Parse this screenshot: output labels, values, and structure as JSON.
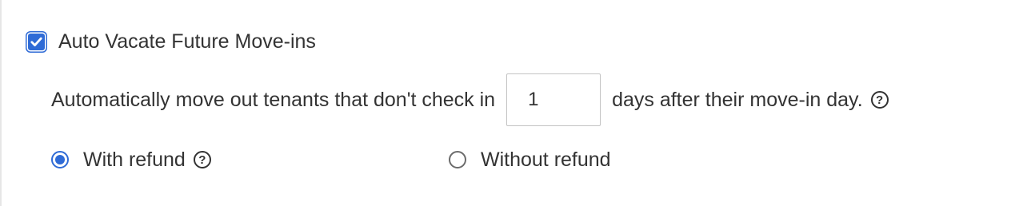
{
  "auto_vacate": {
    "checkbox_label": "Auto Vacate Future Move-ins",
    "checked": true,
    "sentence_before": "Automatically move out tenants that don't check in",
    "days_value": "1",
    "sentence_after": "days after their move-in day.",
    "help_glyph": "?"
  },
  "refund_options": {
    "selected": "with_refund",
    "with_refund_label": "With refund",
    "with_refund_help_glyph": "?",
    "without_refund_label": "Without refund"
  },
  "colors": {
    "accent": "#2f6bd6",
    "text": "#333333",
    "input_border": "#c4c4c4"
  },
  "icons": {
    "checkbox": "checkmark-icon",
    "help": "question-circle-icon"
  }
}
